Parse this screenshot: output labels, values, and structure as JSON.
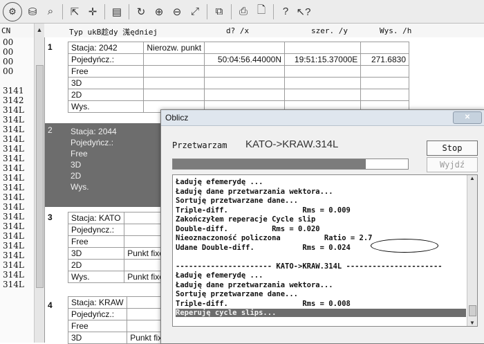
{
  "toolbar": {
    "icons": [
      "round-icon",
      "disk-icon",
      "zoom-icon",
      "cursor-icon",
      "crosshair-icon",
      "table-icon",
      "refresh-icon",
      "zoom-in-icon",
      "zoom-out-icon",
      "zoom-fit-icon",
      "layers-icon",
      "print-icon",
      "preview-icon",
      "help-icon",
      "whatsthis-icon"
    ]
  },
  "header": {
    "col_cn": "CN",
    "col_typ": "Typ ukB趁dy 溬ędniej",
    "col_d": "d? /x",
    "col_szer": "szer. /y",
    "col_wys": "Wys. /h"
  },
  "left_rows": [
    "00",
    "00",
    "00",
    "00",
    "",
    "3141",
    "3142",
    "314L",
    "314L",
    "314L",
    "314L",
    "314L",
    "314L",
    "314L",
    "314L",
    "314L",
    "314L",
    "314L",
    "314L",
    "314L",
    "314L",
    "314L",
    "314L",
    "314L",
    "314L",
    "314L"
  ],
  "blocks": [
    {
      "num": "1",
      "station": "Stacja: 2042",
      "type": "Nierozw. punkt",
      "pojedyncz": "Pojedyńcz.:",
      "lat": "50:04:56.44000N",
      "lon": "19:51:15.37000E",
      "h": "271.6830",
      "free": "Free",
      "d3": "3D",
      "d2": "2D",
      "wys": "Wys."
    },
    {
      "num": "2",
      "station": "Stacja: 2044",
      "pojedyncz": "Pojedyńcz.:",
      "free": "Free",
      "d3": "3D",
      "d2": "2D",
      "wys": "Wys."
    },
    {
      "num": "3",
      "station": "Stacja: KATO",
      "pojedyncz": "Pojedyncz.:",
      "free": "Free",
      "d3": "3D",
      "d2": "2D",
      "wys": "Wys.",
      "fixed": "Punkt fixed"
    },
    {
      "num": "4",
      "station": "Stacja: KRAW",
      "pojedyncz": "Pojedyńcz.:",
      "free": "Free",
      "d3": "3D",
      "fixed": "Punkt fixed"
    }
  ],
  "dialog": {
    "title": "Oblicz",
    "processing_label": "Przetwarzam",
    "processing_target": "KATO->KRAW.314L",
    "progress": 0.82,
    "stop": "Stop",
    "exit": "Wyjdź",
    "log": [
      "Ładuję efemerydę ...",
      "Ładuję dane przetwarzania wektora...",
      "Sortuję przetwarzane dane...",
      "Triple-diff.                 Rms = 0.009",
      "Zakończyłem reperacje Cycle slip",
      "Double-diff.          Rms = 0.020",
      "Nieoznaczoność policzona          Ratio = 2.7",
      "Udane Double-diff.           Rms = 0.024",
      "",
      "---------------------- KATO->KRAW.314L ----------------------",
      "Ładuję efemerydę ...",
      "Ładuję dane przetwarzania wektora...",
      "Sortuję przetwarzane dane...",
      "Triple-diff.                 Rms = 0.008",
      "Reperuję cycle slips..."
    ]
  }
}
